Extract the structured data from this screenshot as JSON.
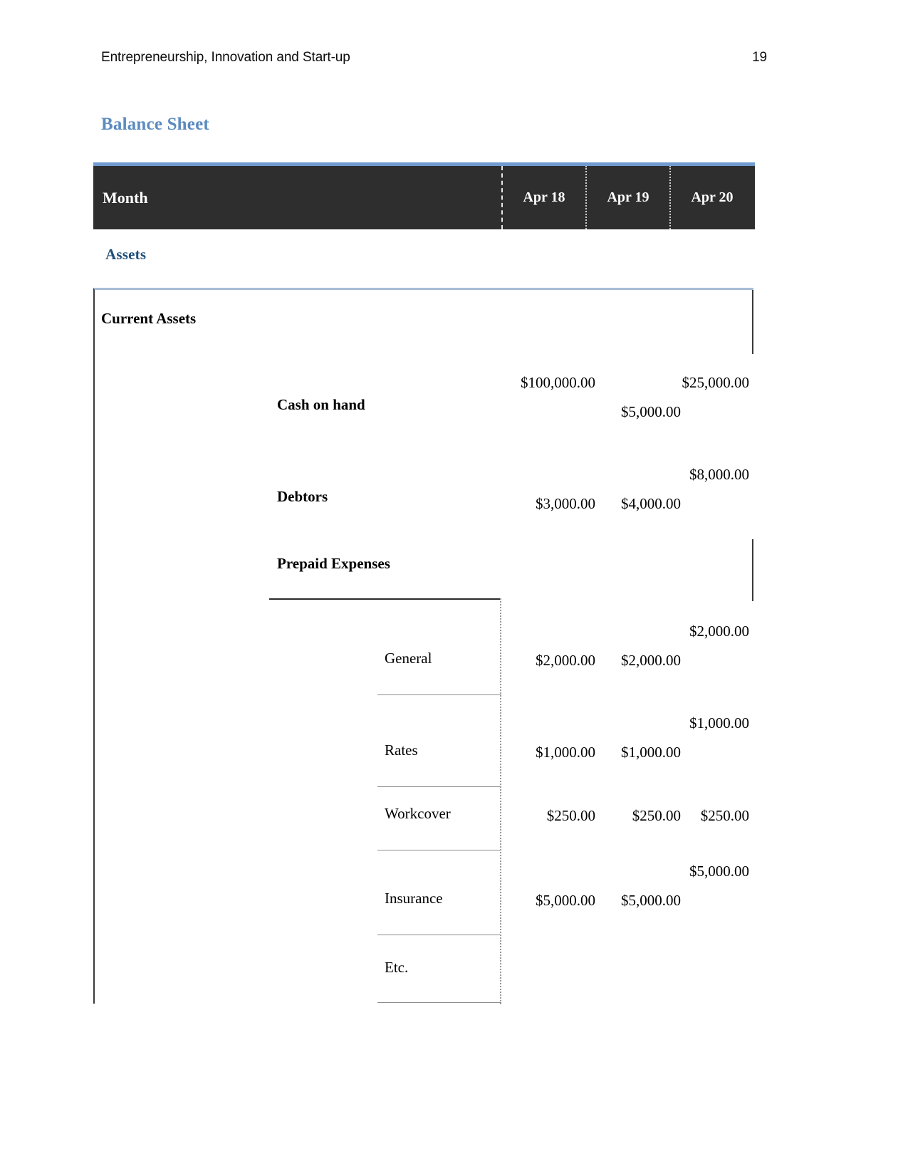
{
  "header": {
    "running_title": "Entrepreneurship, Innovation and Start-up",
    "page_number": "19"
  },
  "heading": {
    "title": "Balance Sheet",
    "color": "#5b8bc0"
  },
  "month_table": {
    "row_label": "Month",
    "columns": [
      "Apr 18",
      "Apr 19",
      "Apr 20"
    ],
    "background": "#2e2e2e",
    "top_border_color": "#6f9bd1",
    "text_color": "#ffffff"
  },
  "section": {
    "assets_heading": "Assets",
    "assets_heading_color": "#1f4e79",
    "current_assets_title": "Current Assets",
    "box_top_border_color": "#a8bdd6"
  },
  "rows_level1": [
    {
      "label": "Cash on hand",
      "apr18": "$100,000.00",
      "apr19": "$5,000.00",
      "apr20": "$25,000.00"
    },
    {
      "label": "Debtors",
      "apr18": "$3,000.00",
      "apr19": "$4,000.00",
      "apr20": "$8,000.00"
    }
  ],
  "prepaid": {
    "title": "Prepaid Expenses",
    "rows": [
      {
        "label": "General",
        "apr18": "$2,000.00",
        "apr19": "$2,000.00",
        "apr20": "$2,000.00"
      },
      {
        "label": "Rates",
        "apr18": "$1,000.00",
        "apr19": "$1,000.00",
        "apr20": "$1,000.00"
      },
      {
        "label": "Workcover",
        "apr18": "$250.00",
        "apr19": "$250.00",
        "apr20": "$250.00"
      },
      {
        "label": "Insurance",
        "apr18": "$5,000.00",
        "apr19": "$5,000.00",
        "apr20": "$5,000.00"
      },
      {
        "label": "Etc.",
        "apr18": "",
        "apr19": "",
        "apr20": ""
      }
    ]
  }
}
